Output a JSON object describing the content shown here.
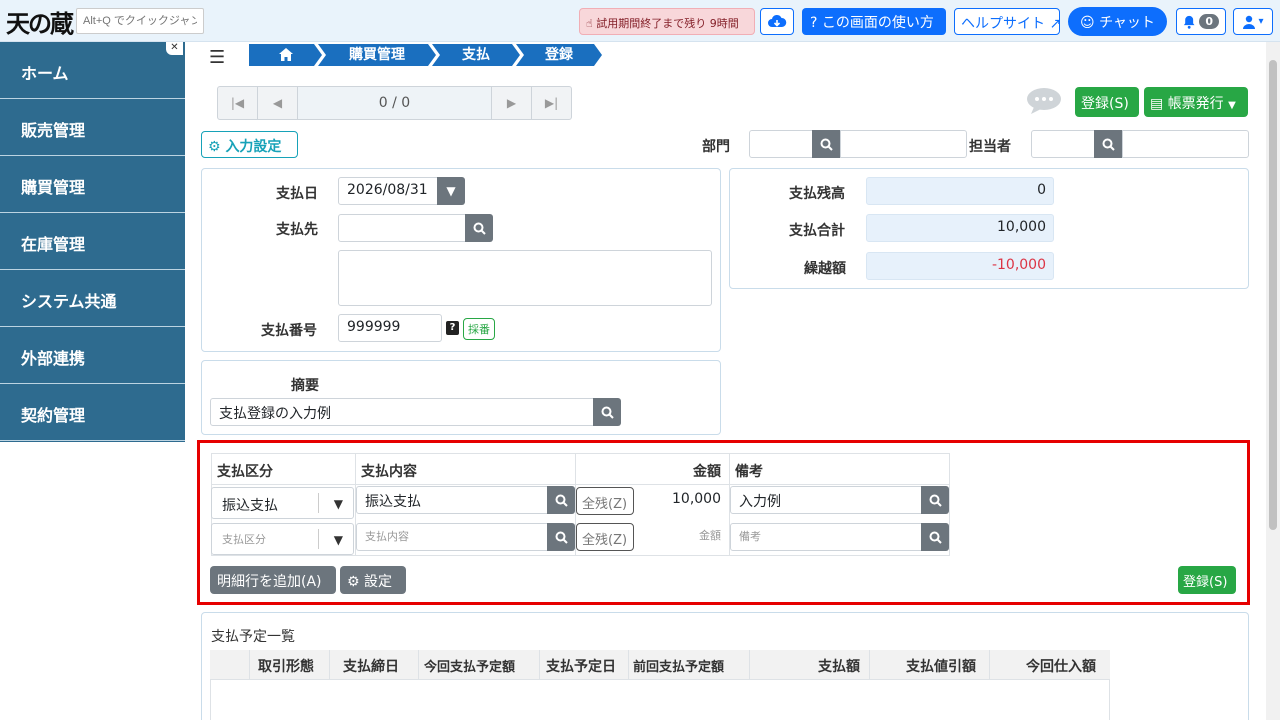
{
  "header": {
    "logo_text": "天の蔵",
    "quick_jump_placeholder": "Alt+Q でクイックジャンプ",
    "trial_notice": "試用期間終了まで残り 9時間",
    "howto_label": "? この画面の使い方",
    "help_site_label": "ヘルプサイト",
    "chat_label": "チャット",
    "notification_count": "0"
  },
  "sidebar": {
    "items": [
      {
        "label": "ホーム"
      },
      {
        "label": "販売管理"
      },
      {
        "label": "購買管理"
      },
      {
        "label": "在庫管理"
      },
      {
        "label": "システム共通"
      },
      {
        "label": "外部連携"
      },
      {
        "label": "契約管理"
      }
    ]
  },
  "breadcrumb": [
    "購買管理",
    "支払",
    "登録"
  ],
  "pager": {
    "counter": "0 / 0"
  },
  "toolbar": {
    "register_label": "登録(S)",
    "report_label": "帳票発行",
    "input_settings_label": "入力設定"
  },
  "filters": {
    "department_label": "部門",
    "staff_label": "担当者"
  },
  "form": {
    "payment_date_label": "支払日",
    "payment_date_value": "2026/08/31",
    "payee_label": "支払先",
    "payment_number_label": "支払番号",
    "payment_number_value": "999999",
    "saiban_label": "採番",
    "summary_label": "摘要",
    "summary_value": "支払登録の入力例"
  },
  "totals": {
    "balance_label": "支払残高",
    "balance_value": "0",
    "total_label": "支払合計",
    "total_value": "10,000",
    "carryover_label": "繰越額",
    "carryover_value": "-10,000"
  },
  "details": {
    "headers": {
      "type": "支払区分",
      "content": "支払内容",
      "amount": "金額",
      "note": "備考"
    },
    "rows": [
      {
        "type": "振込支払",
        "content": "振込支払",
        "zenzan": "全残(Z)",
        "amount": "10,000",
        "note": "入力例"
      }
    ],
    "placeholders": {
      "type": "支払区分",
      "content": "支払内容",
      "zenzan": "全残(Z)",
      "amount": "金額",
      "note": "備考"
    },
    "add_row_label": "明細行を追加(A)",
    "settings_label": "設定",
    "register_label": "登録(S)"
  },
  "schedule": {
    "title": "支払予定一覧",
    "columns": [
      "取引形態",
      "支払締日",
      "今回支払予定額",
      "支払予定日",
      "前回支払予定額",
      "支払額",
      "支払値引額",
      "今回仕入額"
    ]
  },
  "colors": {
    "accent": "#0d6efd",
    "sidebar": "#2e6b8f",
    "success": "#28a745",
    "highlight": "#e60000",
    "negative": "#dc3545"
  }
}
